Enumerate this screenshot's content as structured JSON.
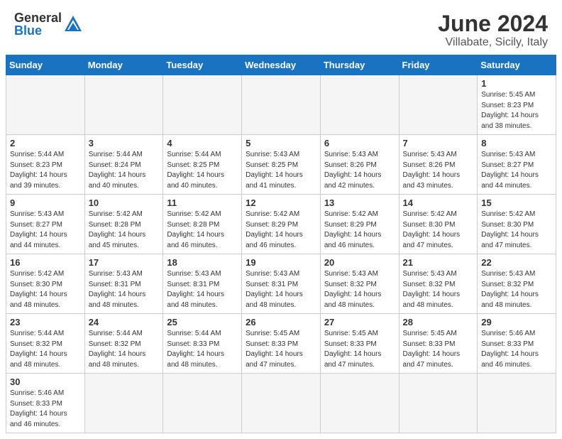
{
  "logo": {
    "general": "General",
    "blue": "Blue"
  },
  "title": "June 2024",
  "subtitle": "Villabate, Sicily, Italy",
  "weekdays": [
    "Sunday",
    "Monday",
    "Tuesday",
    "Wednesday",
    "Thursday",
    "Friday",
    "Saturday"
  ],
  "weeks": [
    [
      {
        "day": "",
        "empty": true
      },
      {
        "day": "",
        "empty": true
      },
      {
        "day": "",
        "empty": true
      },
      {
        "day": "",
        "empty": true
      },
      {
        "day": "",
        "empty": true
      },
      {
        "day": "",
        "empty": true
      },
      {
        "day": "1",
        "sunrise": "5:45 AM",
        "sunset": "8:23 PM",
        "daylight": "14 hours and 38 minutes."
      }
    ],
    [
      {
        "day": "2",
        "sunrise": "5:44 AM",
        "sunset": "8:23 PM",
        "daylight": "14 hours and 39 minutes."
      },
      {
        "day": "3",
        "sunrise": "5:44 AM",
        "sunset": "8:24 PM",
        "daylight": "14 hours and 40 minutes."
      },
      {
        "day": "4",
        "sunrise": "5:44 AM",
        "sunset": "8:25 PM",
        "daylight": "14 hours and 40 minutes."
      },
      {
        "day": "5",
        "sunrise": "5:43 AM",
        "sunset": "8:25 PM",
        "daylight": "14 hours and 41 minutes."
      },
      {
        "day": "6",
        "sunrise": "5:43 AM",
        "sunset": "8:26 PM",
        "daylight": "14 hours and 42 minutes."
      },
      {
        "day": "7",
        "sunrise": "5:43 AM",
        "sunset": "8:26 PM",
        "daylight": "14 hours and 43 minutes."
      },
      {
        "day": "8",
        "sunrise": "5:43 AM",
        "sunset": "8:27 PM",
        "daylight": "14 hours and 44 minutes."
      }
    ],
    [
      {
        "day": "9",
        "sunrise": "5:43 AM",
        "sunset": "8:27 PM",
        "daylight": "14 hours and 44 minutes."
      },
      {
        "day": "10",
        "sunrise": "5:42 AM",
        "sunset": "8:28 PM",
        "daylight": "14 hours and 45 minutes."
      },
      {
        "day": "11",
        "sunrise": "5:42 AM",
        "sunset": "8:28 PM",
        "daylight": "14 hours and 46 minutes."
      },
      {
        "day": "12",
        "sunrise": "5:42 AM",
        "sunset": "8:29 PM",
        "daylight": "14 hours and 46 minutes."
      },
      {
        "day": "13",
        "sunrise": "5:42 AM",
        "sunset": "8:29 PM",
        "daylight": "14 hours and 46 minutes."
      },
      {
        "day": "14",
        "sunrise": "5:42 AM",
        "sunset": "8:30 PM",
        "daylight": "14 hours and 47 minutes."
      },
      {
        "day": "15",
        "sunrise": "5:42 AM",
        "sunset": "8:30 PM",
        "daylight": "14 hours and 47 minutes."
      }
    ],
    [
      {
        "day": "16",
        "sunrise": "5:42 AM",
        "sunset": "8:30 PM",
        "daylight": "14 hours and 48 minutes."
      },
      {
        "day": "17",
        "sunrise": "5:43 AM",
        "sunset": "8:31 PM",
        "daylight": "14 hours and 48 minutes."
      },
      {
        "day": "18",
        "sunrise": "5:43 AM",
        "sunset": "8:31 PM",
        "daylight": "14 hours and 48 minutes."
      },
      {
        "day": "19",
        "sunrise": "5:43 AM",
        "sunset": "8:31 PM",
        "daylight": "14 hours and 48 minutes."
      },
      {
        "day": "20",
        "sunrise": "5:43 AM",
        "sunset": "8:32 PM",
        "daylight": "14 hours and 48 minutes."
      },
      {
        "day": "21",
        "sunrise": "5:43 AM",
        "sunset": "8:32 PM",
        "daylight": "14 hours and 48 minutes."
      },
      {
        "day": "22",
        "sunrise": "5:43 AM",
        "sunset": "8:32 PM",
        "daylight": "14 hours and 48 minutes."
      }
    ],
    [
      {
        "day": "23",
        "sunrise": "5:44 AM",
        "sunset": "8:32 PM",
        "daylight": "14 hours and 48 minutes."
      },
      {
        "day": "24",
        "sunrise": "5:44 AM",
        "sunset": "8:32 PM",
        "daylight": "14 hours and 48 minutes."
      },
      {
        "day": "25",
        "sunrise": "5:44 AM",
        "sunset": "8:33 PM",
        "daylight": "14 hours and 48 minutes."
      },
      {
        "day": "26",
        "sunrise": "5:45 AM",
        "sunset": "8:33 PM",
        "daylight": "14 hours and 47 minutes."
      },
      {
        "day": "27",
        "sunrise": "5:45 AM",
        "sunset": "8:33 PM",
        "daylight": "14 hours and 47 minutes."
      },
      {
        "day": "28",
        "sunrise": "5:45 AM",
        "sunset": "8:33 PM",
        "daylight": "14 hours and 47 minutes."
      },
      {
        "day": "29",
        "sunrise": "5:46 AM",
        "sunset": "8:33 PM",
        "daylight": "14 hours and 46 minutes."
      }
    ],
    [
      {
        "day": "30",
        "sunrise": "5:46 AM",
        "sunset": "8:33 PM",
        "daylight": "14 hours and 46 minutes."
      },
      {
        "day": "",
        "empty": true
      },
      {
        "day": "",
        "empty": true
      },
      {
        "day": "",
        "empty": true
      },
      {
        "day": "",
        "empty": true
      },
      {
        "day": "",
        "empty": true
      },
      {
        "day": "",
        "empty": true
      }
    ]
  ]
}
